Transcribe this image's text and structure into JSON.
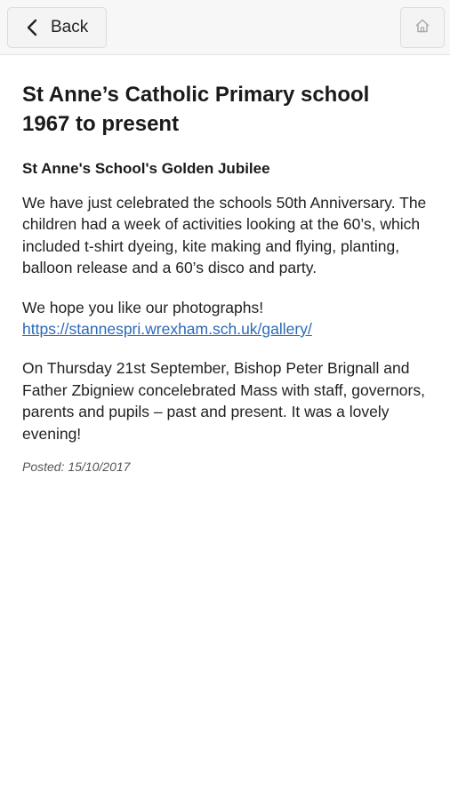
{
  "header": {
    "back_label": "Back",
    "back_icon": "chevron-left-icon",
    "home_icon": "home-icon"
  },
  "article": {
    "title_line1": "St Anne’s Catholic Primary school",
    "title_line2": "1967 to present",
    "subtitle": "St Anne's School's Golden Jubilee",
    "paragraph1": "We have just celebrated the schools 50th Anniversary. The children had a week of activities looking at the 60’s, which included t-shirt dyeing, kite making and flying, planting, balloon release and  a 60’s disco and party.",
    "paragraph2_text": "We hope you like our photographs!",
    "paragraph2_link": "https://stannespri.wrexham.sch.uk/gallery/",
    "paragraph3": "On Thursday 21st September, Bishop Peter Brignall and Father Zbigniew concelebrated Mass with staff, governors, parents and pupils – past and present. It was a lovely evening!",
    "posted": "Posted: 15/10/2017"
  },
  "colors": {
    "link": "#2a6ab8",
    "topbar_bg": "#f7f7f7"
  }
}
